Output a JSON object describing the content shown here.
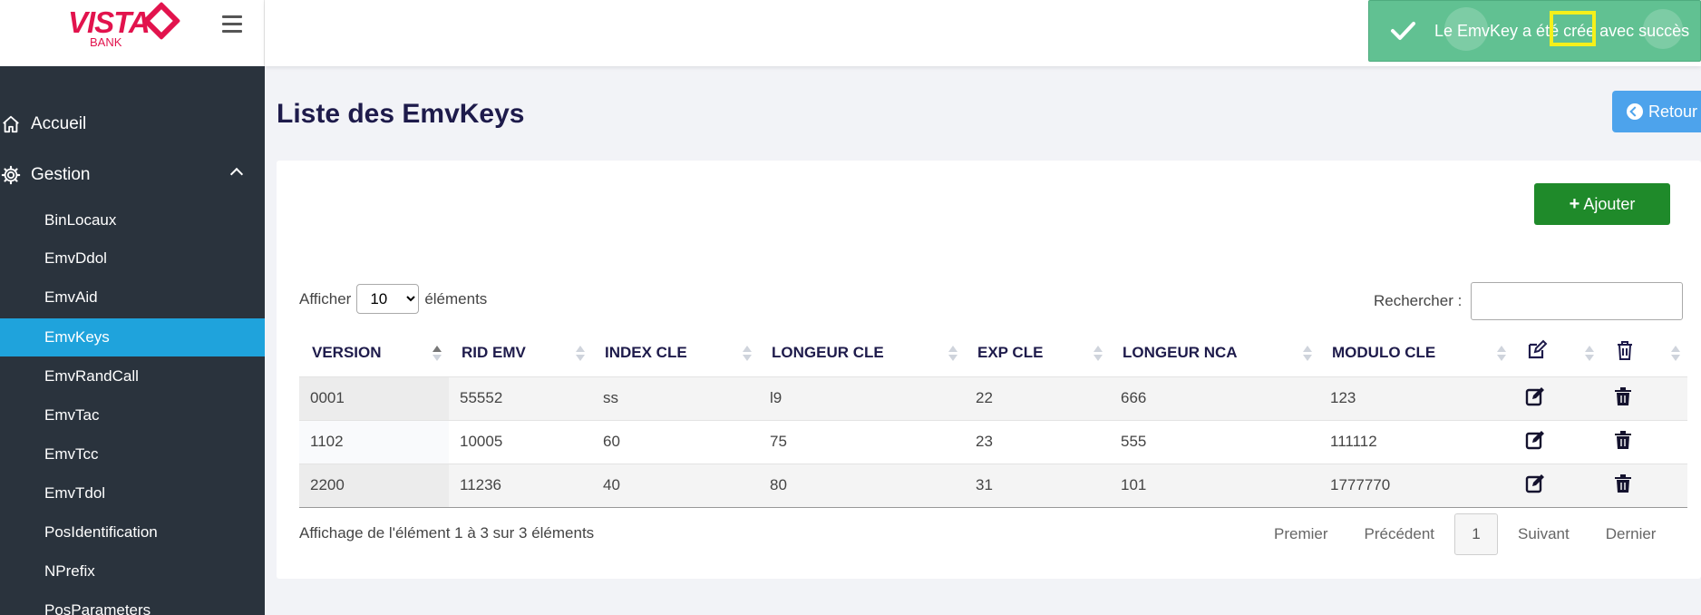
{
  "brand": {
    "name": "VISTA",
    "sub": "BANK"
  },
  "sidebar": {
    "top": [
      {
        "label": "Accueil",
        "icon": "home-icon"
      },
      {
        "label": "Gestion",
        "icon": "gear-icon"
      }
    ],
    "items": [
      "BinLocaux",
      "EmvDdol",
      "EmvAid",
      "EmvKeys",
      "EmvRandCall",
      "EmvTac",
      "EmvTcc",
      "EmvTdol",
      "PosIdentification",
      "NPrefix",
      "PosParameters"
    ],
    "active": "EmvKeys"
  },
  "toast": {
    "message": "Le EmvKey a été crée avec succès",
    "color": "#5cc08f"
  },
  "page": {
    "title": "Liste des EmvKeys",
    "back_label": "Retour",
    "add_label": "Ajouter"
  },
  "controls": {
    "show_prefix": "Afficher",
    "show_value": "10",
    "show_suffix": "éléments",
    "search_label": "Rechercher :"
  },
  "table": {
    "headers": [
      "VERSION",
      "RID EMV",
      "INDEX CLE",
      "LONGEUR CLE",
      "EXP CLE",
      "LONGEUR NCA",
      "MODULO CLE"
    ],
    "rows": [
      [
        "0001",
        "55552",
        "ss",
        "l9",
        "22",
        "666",
        "123"
      ],
      [
        "1102",
        "10005",
        "60",
        "75",
        "23",
        "555",
        "111112"
      ],
      [
        "2200",
        "11236",
        "40",
        "80",
        "31",
        "101",
        "1777770"
      ]
    ]
  },
  "footer": {
    "info": "Affichage de l'élément 1 à 3 sur 3 éléments",
    "first": "Premier",
    "prev": "Précédent",
    "page": "1",
    "next": "Suivant",
    "last": "Dernier"
  },
  "colors": {
    "sidebar_bg": "#2a333d",
    "active": "#1fa3dc",
    "add_button": "#1f8a2a",
    "back_button": "#4da3ec",
    "title": "#1e1b4b"
  }
}
